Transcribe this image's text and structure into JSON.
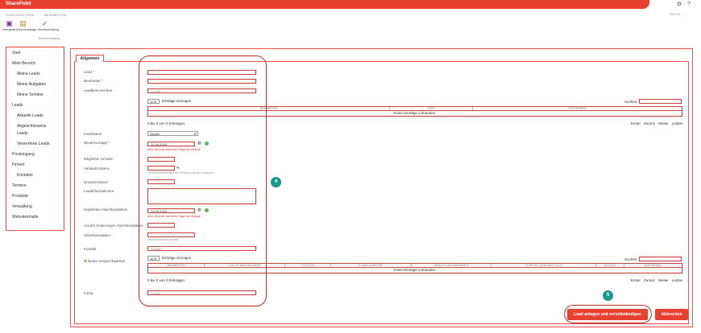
{
  "topbar": {
    "brand": "SharePoint",
    "gear_icon": "⚙",
    "help_icon": "?"
  },
  "tabs": [
    "DURCHSUCHEN",
    "BEARBEITEN"
  ],
  "top_right": {
    "share": "TEILEN",
    "focus_icon": "⛶"
  },
  "ribbon": {
    "buttons": [
      {
        "label": "Übergeben",
        "icon": "save-icon"
      },
      {
        "label": "Zwischenablage",
        "icon": "clipboard-icon"
      },
      {
        "label": "Rechtschreibung",
        "icon": "spellcheck-icon"
      }
    ],
    "group_label": "Rechtschreibung"
  },
  "sidenav": [
    "Start",
    "Mein Bereich",
    "Meine Leads",
    "Meine Aufgaben",
    "Meine Termine",
    "Leads",
    "Aktuelle Leads",
    "Abgeschlossene",
    "Leads",
    "Verworfene Leads",
    "Posteingang",
    "Firmen",
    "Kontakte",
    "Termine",
    "Produkte",
    "Verwaltung",
    "Websiteinhalte"
  ],
  "form": {
    "tab": "Allgemein",
    "lead_label": "Lead",
    "bearbeiter_label": "Bearbeiter",
    "leadkennzeichen_label": "Leadkennzeichen",
    "search_placeholder": "Suchen",
    "page_size": "10",
    "entries_label": "Einträge anzeigen",
    "search_label": "Suchen:",
    "grid1_cols": [
      "BEARBEITEN",
      "TITEL",
      "ENTFERNEN"
    ],
    "empty_text": "Keine Einträge vorhanden.",
    "count_text": "0 bis 0 von 0 Einträgen",
    "pager": [
      "Erster",
      "Zurück",
      "Weiter",
      "Letzter"
    ],
    "leadstatus_label": "Leadstatus",
    "leadstatus_value": "Aktuell",
    "wiedervorlage_label": "Wiedervorlage",
    "wiedervorlage_value": "12.04.2018",
    "week_note": "eine Woche vierzehn Tage ein Monat",
    "umsatz_label": "Möglicher Umsatz",
    "chance_label": "Verkaufschance",
    "percent": "%",
    "chance_hint": "% Wahrscheinlichkeit der Realisierung des Umsatzes",
    "umsatzchance_label": "Umsatzchance",
    "leadinfo_label": "Leadinformationen",
    "abschluss_label": "Geplantes Abschlussdatum",
    "abschluss_value": "19.04.2018",
    "anzahl_label": "Anzahl Änderungen Abschlussdatum",
    "abschlussdatum_label": "Abschlussdatum",
    "auto_hint": "wird automatisch gesetzt",
    "kontakt_label": "Kontakt",
    "ansprech_label": "Neuer Ansprechpartner",
    "grid2_cols": [
      "BEARBEITEN",
      "VOLLSTÄNDIGER NAME",
      "POSITION",
      "E-MAIL-ADRESSE",
      "MOBILTELEFONNUMMER",
      "TELEFON (GESCHÄFTLICH)",
      "DETAILS",
      "ENTFERNEN"
    ],
    "firma_label": "Firma"
  },
  "buttons": {
    "save": "Lead anlegen und vervollständigen",
    "cancel": "Abbrechen"
  },
  "callouts": {
    "form_badge": "4",
    "button_badge": "5"
  }
}
